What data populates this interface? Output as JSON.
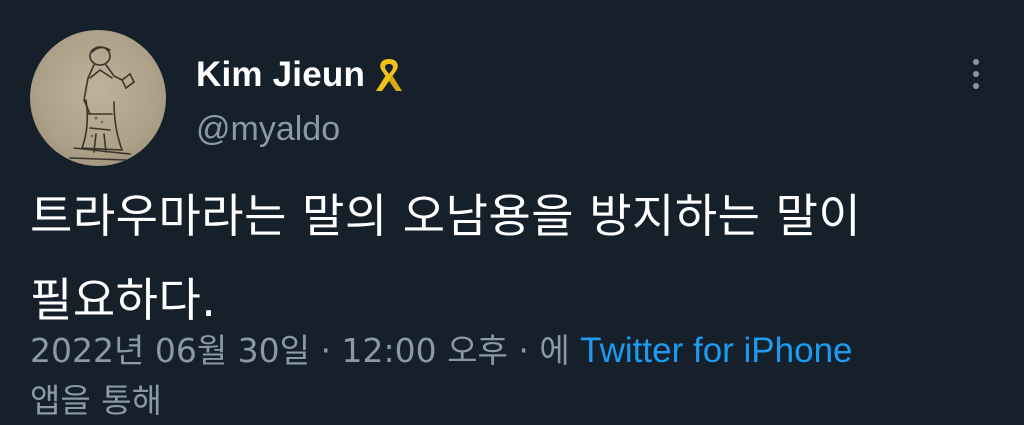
{
  "tweet": {
    "author": {
      "display_name": "Kim Jieun",
      "badge_icon": "yellow-ribbon-icon",
      "handle": "@myaldo",
      "avatar": "sketch-portrait-avatar"
    },
    "more_icon": "vertical-ellipsis-icon",
    "text_lines": [
      "트라우마라는 말의 오남용을 방지하는 말이",
      "필요하다."
    ],
    "meta": {
      "date": "2022년 06월 30일",
      "separator": " · ",
      "time": "12:00 오후",
      "via_prefix": "에 ",
      "source": "Twitter for iPhone",
      "via_suffix": "앱을 통해"
    }
  },
  "colors": {
    "background": "#15202b",
    "primary_text": "#ffffff",
    "secondary_text": "#8b98a5",
    "link": "#1d9bf0",
    "ribbon": "#f2c21b"
  }
}
